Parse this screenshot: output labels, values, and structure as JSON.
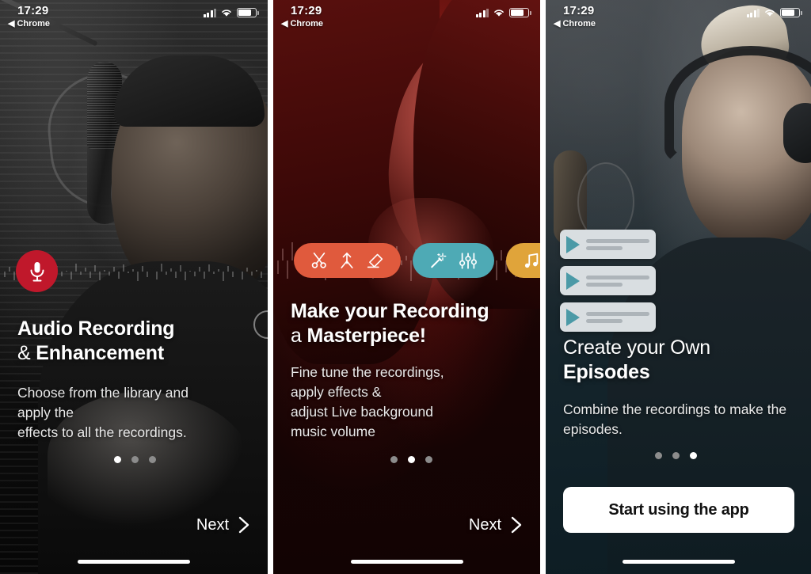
{
  "status_bar": {
    "time": "17:29",
    "back_label": "Chrome",
    "back_arrow": "◀",
    "icons": [
      "cellular-signal-icon",
      "wifi-icon",
      "battery-icon"
    ]
  },
  "colors": {
    "accent_red": "#c0182b",
    "pill_edit": "#e05a3d",
    "pill_tune": "#4eaab5",
    "pill_music": "#e0a43a",
    "play_teal": "#4b9aa7",
    "card_bg": "#d9dee1",
    "dot_active": "#ffffff",
    "dot_inactive": "#8c8c8c",
    "panel1_bg": "#0d0d0d",
    "panel2_bg": "#180606",
    "panel3_bg": "#0f2129"
  },
  "screens": [
    {
      "id": "onboarding-1",
      "badge_icon": "microphone-icon",
      "title_line1": "Audio Recording",
      "title_line2_prefix": "& ",
      "title_line2_bold": "Enhancement",
      "subtitle": "Choose from the library and\napply the\neffects to all the recordings.",
      "subtitle_lines": [
        "Choose from the library and",
        "apply the",
        "effects to all the recordings."
      ],
      "dots": {
        "count": 3,
        "active_index": 0
      },
      "cta_label": "Next",
      "cta_icon": "chevron-right-icon"
    },
    {
      "id": "onboarding-2",
      "pills": [
        {
          "name": "edit-tools-pill",
          "color": "#e05a3d",
          "icons": [
            "scissors-icon",
            "merge-arrow-icon",
            "eraser-icon"
          ]
        },
        {
          "name": "tune-tools-pill",
          "color": "#4eaab5",
          "icons": [
            "magic-wand-icon",
            "equalizer-sliders-icon"
          ]
        },
        {
          "name": "music-pill",
          "color": "#e0a43a",
          "icons": [
            "music-note-icon",
            "waveform-icon"
          ]
        }
      ],
      "title_line1": "Make your Recording",
      "title_line2_prefix": "a ",
      "title_line2_bold": "Masterpiece!",
      "subtitle_lines": [
        "Fine tune the recordings,",
        "apply effects &",
        "adjust Live background",
        "music volume"
      ],
      "dots": {
        "count": 3,
        "active_index": 1
      },
      "cta_label": "Next",
      "cta_icon": "chevron-right-icon"
    },
    {
      "id": "onboarding-3",
      "cards": [
        {
          "name": "episode-card",
          "icon": "play-icon"
        },
        {
          "name": "episode-card",
          "icon": "play-icon"
        },
        {
          "name": "episode-card",
          "icon": "play-icon"
        }
      ],
      "title_line1": "Create your Own",
      "title_line2_bold": "Episodes",
      "subtitle_lines": [
        "Combine the recordings to make the",
        "episodes."
      ],
      "dots": {
        "count": 3,
        "active_index": 2
      },
      "cta_label": "Start using the app"
    }
  ]
}
